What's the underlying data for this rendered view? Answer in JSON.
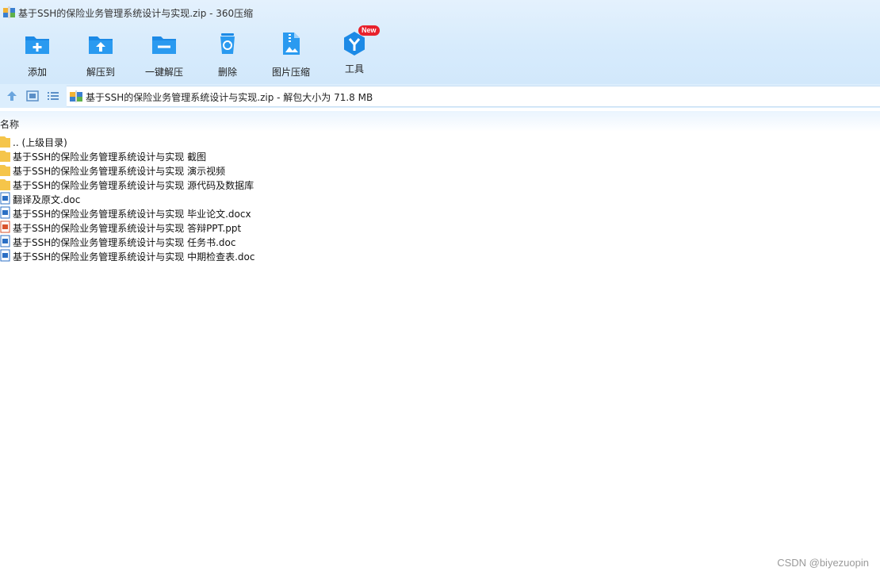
{
  "window": {
    "title": "基于SSH的保险业务管理系统设计与实现.zip - 360压缩"
  },
  "toolbar": {
    "items": [
      {
        "label": "添加",
        "icon": "add-folder-icon"
      },
      {
        "label": "解压到",
        "icon": "extract-to-icon"
      },
      {
        "label": "一键解压",
        "icon": "one-click-extract-icon"
      },
      {
        "label": "删除",
        "icon": "recycle-bin-icon"
      },
      {
        "label": "图片压缩",
        "icon": "image-compress-icon"
      },
      {
        "label": "工具",
        "icon": "tools-icon",
        "badge": "New"
      }
    ]
  },
  "navbar": {
    "address": "基于SSH的保险业务管理系统设计与实现.zip - 解包大小为 71.8 MB"
  },
  "list": {
    "column_name": "名称",
    "rows": [
      {
        "name": ".. (上级目录)",
        "type": "folder"
      },
      {
        "name": "基于SSH的保险业务管理系统设计与实现 截图",
        "type": "folder"
      },
      {
        "name": "基于SSH的保险业务管理系统设计与实现 演示视频",
        "type": "folder"
      },
      {
        "name": "基于SSH的保险业务管理系统设计与实现 源代码及数据库",
        "type": "folder"
      },
      {
        "name": "翻译及原文.doc",
        "type": "doc"
      },
      {
        "name": "基于SSH的保险业务管理系统设计与实现 毕业论文.docx",
        "type": "doc"
      },
      {
        "name": "基于SSH的保险业务管理系统设计与实现 答辩PPT.ppt",
        "type": "ppt"
      },
      {
        "name": "基于SSH的保险业务管理系统设计与实现 任务书.doc",
        "type": "doc"
      },
      {
        "name": "基于SSH的保险业务管理系统设计与实现 中期检查表.doc",
        "type": "doc"
      }
    ]
  },
  "watermark": "CSDN @biyezuopin",
  "colors": {
    "accent": "#1a8fe8",
    "folder": "#f5c54a",
    "badge": "#e8212b"
  }
}
